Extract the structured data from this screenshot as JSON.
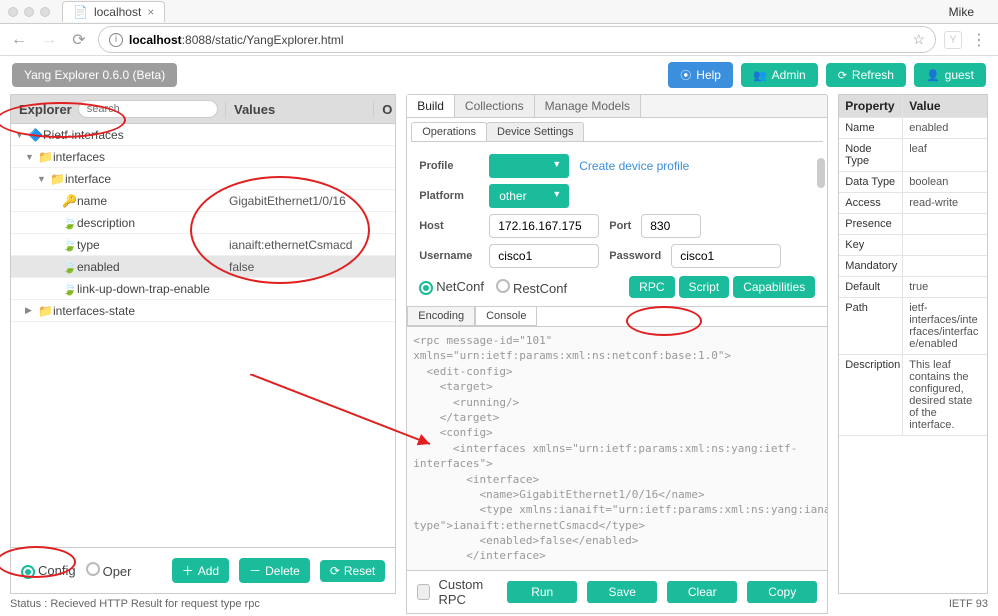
{
  "browser": {
    "tab_title": "localhost",
    "user": "Mike",
    "url_display_bold": "localhost",
    "url_display_rest": ":8088/static/YangExplorer.html"
  },
  "header": {
    "app_title": "Yang Explorer 0.6.0 (Beta)",
    "help": "Help",
    "admin": "Admin",
    "refresh": "Refresh",
    "guest": "guest"
  },
  "explorer": {
    "title": "Explorer",
    "search_placeholder": "search",
    "values_col": "Values",
    "oper_col": "O",
    "nodes": {
      "root": "Rietf-interfaces",
      "interfaces": "interfaces",
      "interface": "interface",
      "name": "name",
      "name_val": "GigabitEthernet1/0/16",
      "description": "description",
      "type": "type",
      "type_val": "ianaift:ethernetCsmacd",
      "enabled": "enabled",
      "enabled_val": "false",
      "linkup": "link-up-down-trap-enable",
      "ifstate": "interfaces-state"
    },
    "bottom": {
      "config": "Config",
      "oper": "Oper",
      "add": "Add",
      "delete": "Delete",
      "reset": "Reset"
    }
  },
  "mid": {
    "tabs": {
      "build": "Build",
      "collections": "Collections",
      "manage": "Manage Models"
    },
    "subtabs": {
      "operations": "Operations",
      "device": "Device Settings"
    },
    "form": {
      "profile_lbl": "Profile",
      "create_link": "Create device profile",
      "platform_lbl": "Platform",
      "platform_val": "other",
      "host_lbl": "Host",
      "host_val": "172.16.167.175",
      "port_lbl": "Port",
      "port_val": "830",
      "user_lbl": "Username",
      "user_val": "cisco1",
      "pass_lbl": "Password",
      "pass_val": "cisco1"
    },
    "protocol": {
      "netconf": "NetConf",
      "restconf": "RestConf"
    },
    "buttons": {
      "rpc": "RPC",
      "script": "Script",
      "caps": "Capabilities"
    },
    "console_tabs": {
      "encoding": "Encoding",
      "console": "Console"
    },
    "console_text": "<rpc message-id=\"101\"\nxmlns=\"urn:ietf:params:xml:ns:netconf:base:1.0\">\n  <edit-config>\n    <target>\n      <running/>\n    </target>\n    <config>\n      <interfaces xmlns=\"urn:ietf:params:xml:ns:yang:ietf-\ninterfaces\">\n        <interface>\n          <name>GigabitEthernet1/0/16</name>\n          <type xmlns:ianaift=\"urn:ietf:params:xml:ns:yang:iana-if-\ntype\">ianaift:ethernetCsmacd</type>\n          <enabled>false</enabled>\n        </interface>",
    "foot": {
      "custom": "Custom RPC",
      "run": "Run",
      "save": "Save",
      "clear": "Clear",
      "copy": "Copy"
    }
  },
  "props": {
    "header_k": "Property",
    "header_v": "Value",
    "rows": [
      {
        "k": "Name",
        "v": "enabled"
      },
      {
        "k": "Node Type",
        "v": "leaf"
      },
      {
        "k": "Data Type",
        "v": "boolean"
      },
      {
        "k": "Access",
        "v": "read-write"
      },
      {
        "k": "Presence",
        "v": ""
      },
      {
        "k": "Key",
        "v": ""
      },
      {
        "k": "Mandatory",
        "v": ""
      },
      {
        "k": "Default",
        "v": "true"
      },
      {
        "k": "Path",
        "v": "ietf-interfaces/interfaces/interface/enabled"
      },
      {
        "k": "Description",
        "v": "This leaf contains the configured, desired state of the interface."
      }
    ]
  },
  "status": {
    "left": "Status : Recieved HTTP Result for request type rpc",
    "right": "IETF 93"
  }
}
